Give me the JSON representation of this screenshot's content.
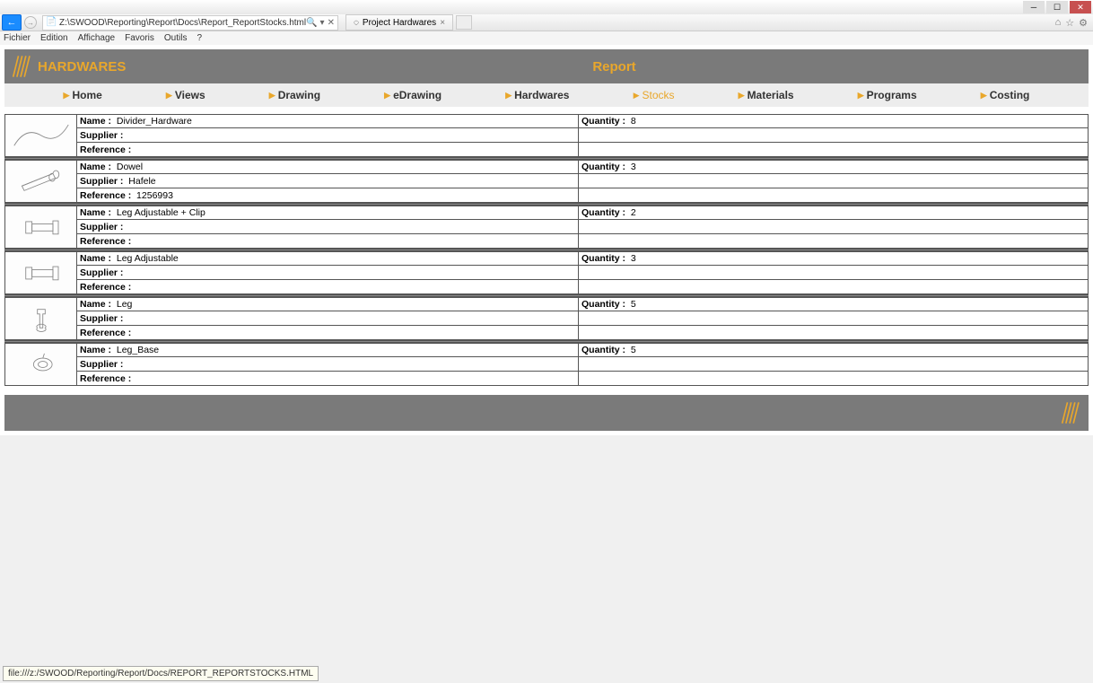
{
  "window": {
    "address": "Z:\\SWOOD\\Reporting\\Report\\Docs\\Report_ReportStocks.html",
    "tab_title": "Project Hardwares",
    "menus": [
      "Fichier",
      "Edition",
      "Affichage",
      "Favoris",
      "Outils",
      "?"
    ],
    "status": "file:///z:/SWOOD/Reporting/Report/Docs/REPORT_REPORTSTOCKS.HTML"
  },
  "header": {
    "title": "HARDWARES",
    "section": "Report"
  },
  "nav": [
    {
      "label": "Home",
      "active": false
    },
    {
      "label": "Views",
      "active": false
    },
    {
      "label": "Drawing",
      "active": false
    },
    {
      "label": "eDrawing",
      "active": false
    },
    {
      "label": "Hardwares",
      "active": false
    },
    {
      "label": "Stocks",
      "active": true
    },
    {
      "label": "Materials",
      "active": false
    },
    {
      "label": "Programs",
      "active": false
    },
    {
      "label": "Costing",
      "active": false
    }
  ],
  "labels": {
    "name": "Name :",
    "supplier": "Supplier :",
    "reference": "Reference :",
    "quantity": "Quantity :"
  },
  "items": [
    {
      "name": "Divider_Hardware",
      "supplier": "",
      "reference": "",
      "quantity": "8",
      "icon": "divider"
    },
    {
      "name": "Dowel",
      "supplier": "Hafele",
      "reference": "1256993",
      "quantity": "3",
      "icon": "dowel"
    },
    {
      "name": "Leg Adjustable + Clip",
      "supplier": "",
      "reference": "",
      "quantity": "2",
      "icon": "leg-adj-clip"
    },
    {
      "name": "Leg Adjustable",
      "supplier": "",
      "reference": "",
      "quantity": "3",
      "icon": "leg-adj"
    },
    {
      "name": "Leg",
      "supplier": "",
      "reference": "",
      "quantity": "5",
      "icon": "leg"
    },
    {
      "name": "Leg_Base",
      "supplier": "",
      "reference": "",
      "quantity": "5",
      "icon": "leg-base"
    }
  ]
}
